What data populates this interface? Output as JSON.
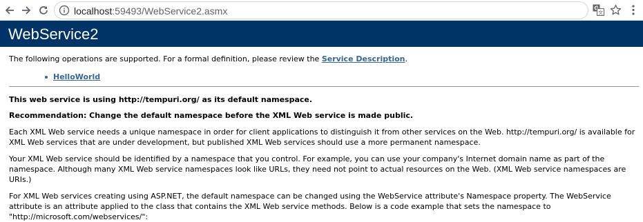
{
  "browser": {
    "url_host": "localhost",
    "url_rest": ":59493/WebService2.asmx"
  },
  "header": {
    "title": "WebService2"
  },
  "intro": {
    "text": "The following operations are supported. For a formal definition, please review the ",
    "link": "Service Description",
    "suffix": "."
  },
  "operations": [
    "HelloWorld"
  ],
  "notice": {
    "heading": "This web service is using http://tempuri.org/ as its default namespace.",
    "recommendation": "Recommendation: Change the default namespace before the XML Web service is made public.",
    "para1": "Each XML Web service needs a unique namespace in order for client applications to distinguish it from other services on the Web. http://tempuri.org/ is available for XML Web services that are under development, but published XML Web services should use a more permanent namespace.",
    "para2": "Your XML Web service should be identified by a namespace that you control. For example, you can use your company's Internet domain name as part of the namespace. Although many XML Web service namespaces look like URLs, they need not point to actual resources on the Web. (XML Web service namespaces are URIs.)",
    "para3": "For XML Web services creating using ASP.NET, the default namespace can be changed using the WebService attribute's Namespace property. The WebService attribute is an attribute applied to the class that contains the XML Web service methods. Below is a code example that sets the namespace to \"http://microsoft.com/webservices/\":"
  },
  "colors": {
    "header_bg": "#003366",
    "link": "#336699"
  },
  "icons": [
    "back-arrow-icon",
    "forward-arrow-icon",
    "reload-icon",
    "info-icon",
    "translate-icon",
    "star-icon",
    "kebab-menu-icon"
  ]
}
